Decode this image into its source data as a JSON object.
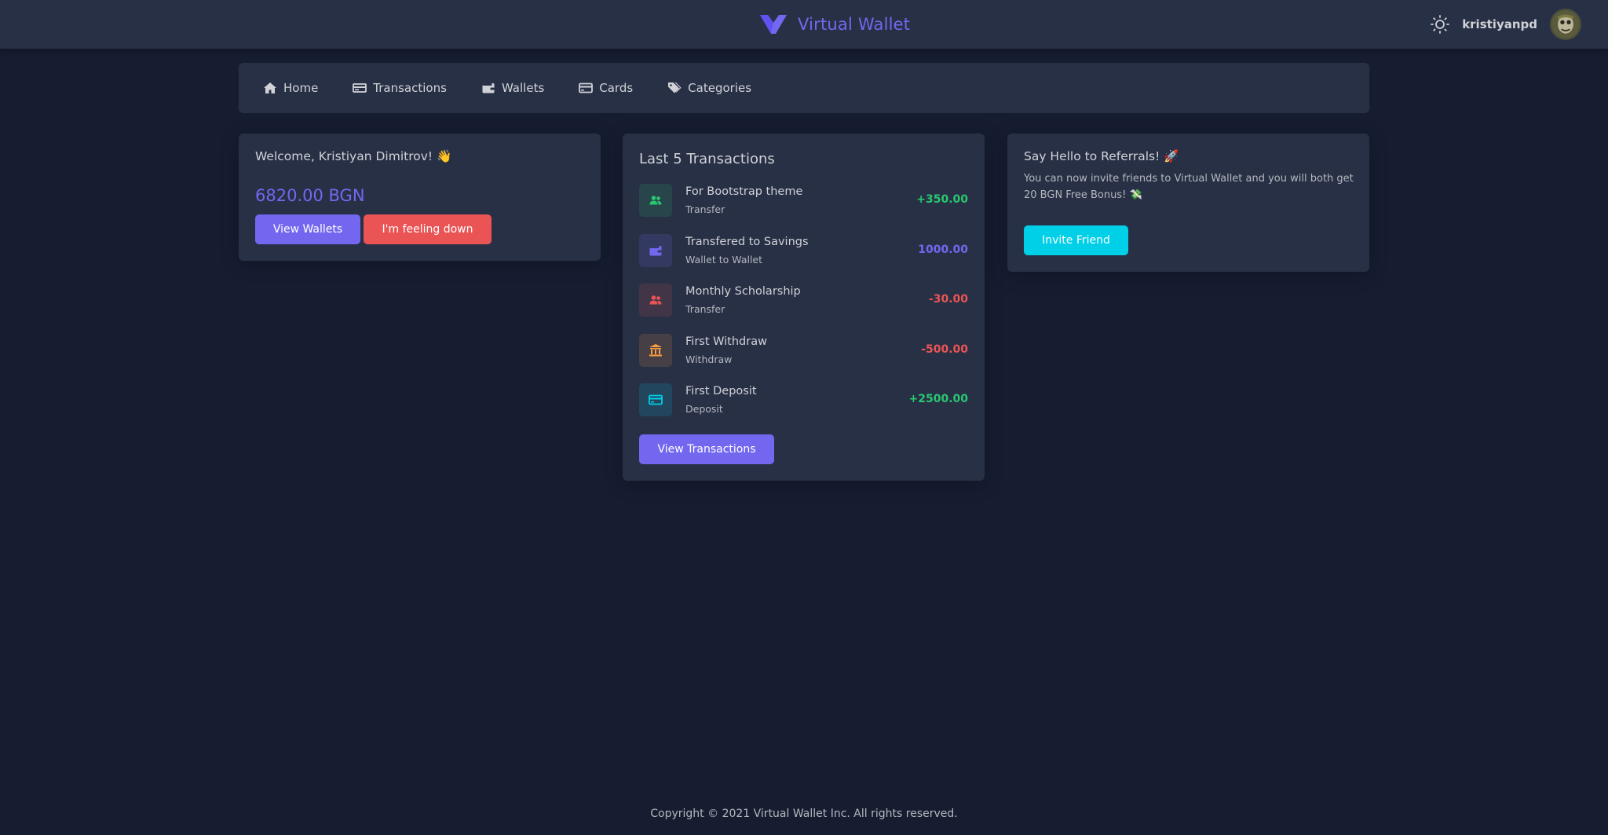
{
  "header": {
    "brand_name": "Virtual Wallet",
    "username": "kristiyanpd",
    "accent_color": "#7367f0"
  },
  "nav": {
    "items": [
      {
        "label": "Home",
        "icon": "home-icon"
      },
      {
        "label": "Transactions",
        "icon": "money-bill-icon"
      },
      {
        "label": "Wallets",
        "icon": "wallet-icon"
      },
      {
        "label": "Cards",
        "icon": "credit-card-icon"
      },
      {
        "label": "Categories",
        "icon": "tags-icon"
      }
    ]
  },
  "welcome": {
    "title": "Welcome, Kristiyan Dimitrov! 👋",
    "balance": "6820.00 BGN",
    "view_wallets_label": "View Wallets",
    "feeling_down_label": "I'm feeling down"
  },
  "transactions": {
    "title": "Last 5 Transactions",
    "items": [
      {
        "name": "For Bootstrap theme",
        "type": "Transfer",
        "amount": "+350.00",
        "amount_color": "#28c76f",
        "icon": "users-icon",
        "icon_color": "#28c76f"
      },
      {
        "name": "Transfered to Savings",
        "type": "Wallet to Wallet",
        "amount": "1000.00",
        "amount_color": "#7367f0",
        "icon": "wallet-icon",
        "icon_color": "#7367f0"
      },
      {
        "name": "Monthly Scholarship",
        "type": "Transfer",
        "amount": "-30.00",
        "amount_color": "#ea5455",
        "icon": "users-icon",
        "icon_color": "#ea5455"
      },
      {
        "name": "First Withdraw",
        "type": "Withdraw",
        "amount": "-500.00",
        "amount_color": "#ea5455",
        "icon": "bank-icon",
        "icon_color": "#ff9f43"
      },
      {
        "name": "First Deposit",
        "type": "Deposit",
        "amount": "+2500.00",
        "amount_color": "#28c76f",
        "icon": "credit-card-icon",
        "icon_color": "#00cfe8"
      }
    ],
    "view_transactions_label": "View Transactions"
  },
  "referral": {
    "title": "Say Hello to Referrals! 🚀",
    "text": "You can now invite friends to Virtual Wallet and you will both get 20 BGN Free Bonus! 💸",
    "invite_label": "Invite Friend"
  },
  "footer": {
    "copyright": "Copyright © 2021 Virtual Wallet Inc. All rights reserved."
  }
}
